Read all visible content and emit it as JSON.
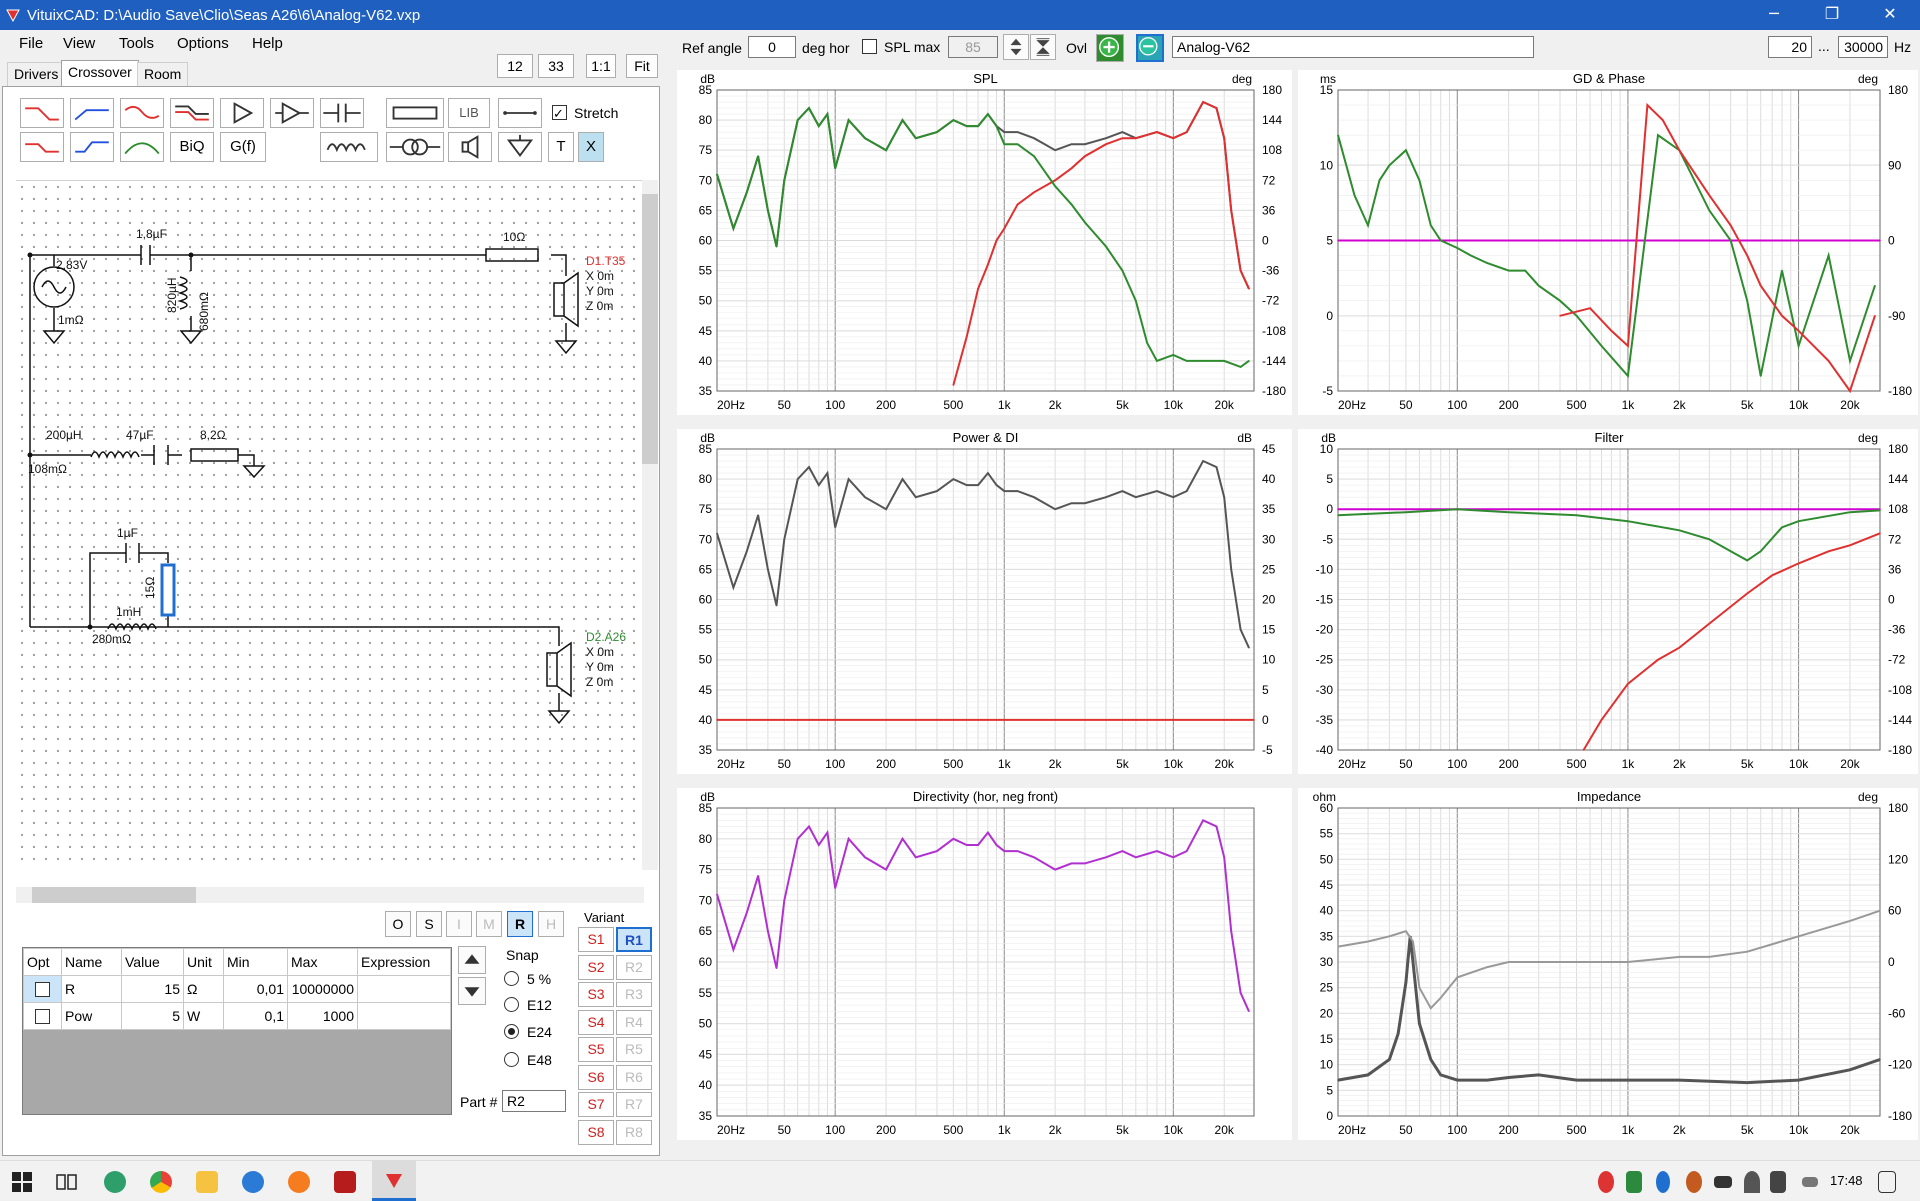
{
  "window": {
    "title": "VituixCAD: D:\\Audio Save\\Clio\\Seas A26\\6\\Analog-V62.vxp",
    "min": "─",
    "restore": "❐",
    "close": "✕"
  },
  "menu": [
    "File",
    "View",
    "Tools",
    "Options",
    "Help"
  ],
  "tabs": [
    "Drivers",
    "Crossover",
    "Room"
  ],
  "schem_toolbar": {
    "v12": "12",
    "v33": "33",
    "one": "1:1",
    "fit": "Fit",
    "lib": "LIB",
    "biq": "BiQ",
    "gf": "G(f)",
    "t": "T",
    "x": "X",
    "stretch": "Stretch"
  },
  "schematic": {
    "src_v": "2,83V",
    "src_r": "1mΩ",
    "c1": "1,8µF",
    "l1": "820µH",
    "l1r": "680mΩ",
    "r1": "10Ω",
    "d1": {
      "name": "D1.T35",
      "x": "X 0m",
      "y": "Y 0m",
      "z": "Z 0m"
    },
    "l2": "200µH",
    "l2r": "108mΩ",
    "c2": "47µF",
    "r2": "8,2Ω",
    "c3": "1µF",
    "r3": "15Ω",
    "l3": "1mH",
    "l3r": "280mΩ",
    "d2": {
      "name": "D2.A26",
      "x": "X 0m",
      "y": "Y 0m",
      "z": "Z 0m"
    }
  },
  "modes": [
    "O",
    "S",
    "I",
    "M",
    "R",
    "H"
  ],
  "param_table": {
    "headers": [
      "Opt",
      "Name",
      "Value",
      "Unit",
      "Min",
      "Max",
      "Expression"
    ],
    "rows": [
      [
        "",
        "R",
        "15",
        "Ω",
        "0,01",
        "10000000",
        ""
      ],
      [
        "",
        "Pow",
        "5",
        "W",
        "0,1",
        "1000",
        ""
      ]
    ]
  },
  "snap": {
    "label": "Snap",
    "options": [
      "5 %",
      "E12",
      "E24",
      "E48"
    ],
    "selected": "E24"
  },
  "part": {
    "label": "Part #",
    "value": "R2"
  },
  "variant": {
    "label": "Variant",
    "s": [
      "S1",
      "S2",
      "S3",
      "S4",
      "S5",
      "S6",
      "S7",
      "S8"
    ],
    "r": [
      "R1",
      "R2",
      "R3",
      "R4",
      "R5",
      "R6",
      "R7",
      "R8"
    ]
  },
  "top_controls": {
    "ref_angle_label": "Ref angle",
    "ref_angle": "0",
    "deg_hor": "deg hor",
    "spl_max_label": "SPL max",
    "spl_max": "85",
    "ovl": "Ovl",
    "variant_name": "Analog-V62",
    "f_low": "20",
    "dots": "...",
    "f_high": "30000",
    "hz": "Hz"
  },
  "colors": {
    "accent": "#1f5fbf",
    "red": "#e03030",
    "green": "#2e8b2e",
    "magenta": "#d000d0",
    "grey": "#555555",
    "purple": "#b030d0"
  },
  "taskbar": {
    "time": "17:48"
  },
  "chart_data": [
    {
      "type": "line",
      "title": "SPL",
      "ylabel": "dB",
      "y2label": "deg",
      "ylim": [
        35,
        85
      ],
      "y2ticks": [
        "180",
        "144",
        "108",
        "72",
        "36",
        "0",
        "-36",
        "-72",
        "-108",
        "-144",
        "-180"
      ],
      "xticks": [
        "20Hz",
        "50",
        "100",
        "200",
        "500",
        "1k",
        "2k",
        "5k",
        "10k",
        "20k"
      ],
      "xlim": [
        20,
        30000
      ],
      "xlog": true,
      "grid": true,
      "series": [
        {
          "color": "#555555",
          "x": [
            20,
            25,
            30,
            35,
            40,
            45,
            50,
            60,
            70,
            80,
            90,
            100,
            120,
            150,
            200,
            250,
            300,
            400,
            500,
            600,
            700,
            800,
            900,
            1000,
            1200,
            1500,
            2000,
            2500,
            3000,
            4000,
            5000,
            6000,
            8000,
            10000,
            12000,
            15000,
            18000,
            20000,
            22000,
            25000,
            28000
          ],
          "y": [
            71,
            62,
            68,
            74,
            65,
            59,
            70,
            80,
            82,
            79,
            81,
            72,
            80,
            77,
            75,
            80,
            77,
            78,
            80,
            79,
            79,
            81,
            79,
            78,
            78,
            77,
            75,
            76,
            76,
            77,
            78,
            77,
            78,
            77,
            78,
            83,
            82,
            77,
            65,
            55,
            52
          ]
        },
        {
          "color": "#e03030",
          "x": [
            500,
            600,
            700,
            800,
            900,
            1000,
            1200,
            1500,
            2000,
            2500,
            3000,
            4000,
            5000,
            6000,
            8000,
            10000,
            12000,
            15000,
            18000,
            20000,
            22000,
            25000,
            28000
          ],
          "y": [
            36,
            44,
            52,
            56,
            60,
            62,
            66,
            68,
            70,
            72,
            74,
            76,
            77,
            77,
            78,
            77,
            78,
            83,
            82,
            77,
            65,
            55,
            52
          ]
        },
        {
          "color": "#2e8b2e",
          "x": [
            20,
            25,
            30,
            35,
            40,
            45,
            50,
            60,
            70,
            80,
            90,
            100,
            120,
            150,
            200,
            250,
            300,
            400,
            500,
            600,
            700,
            800,
            900,
            1000,
            1200,
            1500,
            2000,
            2500,
            3000,
            4000,
            5000,
            6000,
            7000,
            8000,
            10000,
            12000,
            15000,
            20000,
            25000,
            28000
          ],
          "y": [
            71,
            62,
            68,
            74,
            65,
            59,
            70,
            80,
            82,
            79,
            81,
            72,
            80,
            77,
            75,
            80,
            77,
            78,
            80,
            79,
            79,
            81,
            79,
            76,
            76,
            74,
            69,
            66,
            63,
            59,
            55,
            50,
            43,
            40,
            41,
            40,
            40,
            40,
            39,
            40
          ]
        }
      ]
    },
    {
      "type": "line",
      "title": "GD & Phase",
      "ylabel": "ms",
      "y2label": "deg",
      "ylim": [
        -5,
        15
      ],
      "y2ticks": [
        "180",
        "90",
        "0",
        "-90",
        "-180"
      ],
      "xticks": [
        "20Hz",
        "50",
        "100",
        "200",
        "500",
        "1k",
        "2k",
        "5k",
        "10k",
        "20k"
      ],
      "xlim": [
        20,
        30000
      ],
      "xlog": true,
      "grid": true,
      "series": [
        {
          "color": "#d000d0",
          "x": [
            20,
            30000
          ],
          "y": [
            5,
            5
          ]
        },
        {
          "color": "#2e8b2e",
          "x": [
            20,
            25,
            30,
            35,
            40,
            50,
            60,
            70,
            80,
            100,
            120,
            150,
            200,
            250,
            300,
            400,
            500,
            700,
            1000,
            1500,
            2000,
            3000,
            4000,
            5000,
            6000,
            8000,
            10000,
            15000,
            20000,
            28000
          ],
          "y": [
            12,
            8,
            6,
            9,
            10,
            11,
            9,
            6,
            5,
            4.5,
            4,
            3.5,
            3,
            3,
            2,
            1,
            0,
            -2,
            -4,
            12,
            11,
            7,
            5,
            1,
            -4,
            3,
            -2,
            4,
            -3,
            2
          ]
        },
        {
          "color": "#e03030",
          "x": [
            400,
            600,
            800,
            1000,
            1300,
            1600,
            2000,
            3000,
            4000,
            5000,
            6000,
            8000,
            10000,
            15000,
            20000,
            28000
          ],
          "y": [
            0,
            0.5,
            -1,
            -2,
            14,
            13,
            11,
            8,
            6,
            4,
            2,
            0,
            -1,
            -3,
            -5,
            0
          ]
        }
      ]
    },
    {
      "type": "line",
      "title": "Power & DI",
      "ylabel": "dB",
      "y2label": "dB",
      "ylim": [
        35,
        85
      ],
      "y2ticks": [
        "45",
        "40",
        "35",
        "30",
        "25",
        "20",
        "15",
        "10",
        "5",
        "0",
        "-5"
      ],
      "xticks": [
        "20Hz",
        "50",
        "100",
        "200",
        "500",
        "1k",
        "2k",
        "5k",
        "10k",
        "20k"
      ],
      "xlim": [
        20,
        30000
      ],
      "xlog": true,
      "grid": true,
      "series": [
        {
          "color": "#555555",
          "x": [
            20,
            25,
            30,
            35,
            40,
            45,
            50,
            60,
            70,
            80,
            90,
            100,
            120,
            150,
            200,
            250,
            300,
            400,
            500,
            600,
            700,
            800,
            900,
            1000,
            1200,
            1500,
            2000,
            2500,
            3000,
            4000,
            5000,
            6000,
            8000,
            10000,
            12000,
            15000,
            18000,
            20000,
            22000,
            25000,
            28000
          ],
          "y": [
            71,
            62,
            68,
            74,
            65,
            59,
            70,
            80,
            82,
            79,
            81,
            72,
            80,
            77,
            75,
            80,
            77,
            78,
            80,
            79,
            79,
            81,
            79,
            78,
            78,
            77,
            75,
            76,
            76,
            77,
            78,
            77,
            78,
            77,
            78,
            83,
            82,
            77,
            65,
            55,
            52
          ]
        },
        {
          "color": "#e03030",
          "x": [
            20,
            30000
          ],
          "y": [
            40,
            40
          ]
        }
      ]
    },
    {
      "type": "line",
      "title": "Filter",
      "ylabel": "dB",
      "y2label": "deg",
      "ylim": [
        -40,
        10
      ],
      "y2ticks": [
        "180",
        "144",
        "108",
        "72",
        "36",
        "0",
        "-36",
        "-72",
        "-108",
        "-144",
        "-180"
      ],
      "xticks": [
        "20Hz",
        "50",
        "100",
        "200",
        "500",
        "1k",
        "2k",
        "5k",
        "10k",
        "20k"
      ],
      "xlim": [
        20,
        30000
      ],
      "xlog": true,
      "grid": true,
      "series": [
        {
          "color": "#d000d0",
          "x": [
            20,
            30000
          ],
          "y": [
            0,
            0
          ]
        },
        {
          "color": "#2e8b2e",
          "x": [
            20,
            50,
            100,
            200,
            500,
            1000,
            2000,
            3000,
            4000,
            5000,
            6000,
            8000,
            10000,
            20000,
            30000
          ],
          "y": [
            -1,
            -0.5,
            0,
            -0.5,
            -1,
            -2,
            -3.5,
            -5,
            -7,
            -8.5,
            -7,
            -3,
            -2,
            -0.5,
            -0.2
          ]
        },
        {
          "color": "#e03030",
          "x": [
            550,
            700,
            1000,
            1500,
            2000,
            3000,
            5000,
            7000,
            10000,
            15000,
            20000,
            30000
          ],
          "y": [
            -40,
            -35,
            -29,
            -25,
            -23,
            -19,
            -14,
            -11,
            -9,
            -7,
            -6,
            -4
          ]
        }
      ]
    },
    {
      "type": "line",
      "title": "Directivity (hor, neg front)",
      "ylabel": "dB",
      "ylim": [
        35,
        85
      ],
      "xticks": [
        "20Hz",
        "50",
        "100",
        "200",
        "500",
        "1k",
        "2k",
        "5k",
        "10k",
        "20k"
      ],
      "xlim": [
        20,
        30000
      ],
      "xlog": true,
      "grid": true,
      "series": [
        {
          "color": "#b030d0",
          "x": [
            20,
            25,
            30,
            35,
            40,
            45,
            50,
            60,
            70,
            80,
            90,
            100,
            120,
            150,
            200,
            250,
            300,
            400,
            500,
            600,
            700,
            800,
            900,
            1000,
            1200,
            1500,
            2000,
            2500,
            3000,
            4000,
            5000,
            6000,
            8000,
            10000,
            12000,
            15000,
            18000,
            20000,
            22000,
            25000,
            28000
          ],
          "y": [
            71,
            62,
            68,
            74,
            65,
            59,
            70,
            80,
            82,
            79,
            81,
            72,
            80,
            77,
            75,
            80,
            77,
            78,
            80,
            79,
            79,
            81,
            79,
            78,
            78,
            77,
            75,
            76,
            76,
            77,
            78,
            77,
            78,
            77,
            78,
            83,
            82,
            77,
            65,
            55,
            52
          ]
        }
      ]
    },
    {
      "type": "line",
      "title": "Impedance",
      "ylabel": "ohm",
      "y2label": "deg",
      "ylim": [
        0,
        60
      ],
      "y2ticks": [
        "180",
        "120",
        "60",
        "0",
        "-60",
        "-120",
        "-180"
      ],
      "xticks": [
        "20Hz",
        "50",
        "100",
        "200",
        "500",
        "1k",
        "2k",
        "5k",
        "10k",
        "20k"
      ],
      "xlim": [
        20,
        30000
      ],
      "xlog": true,
      "grid": true,
      "series": [
        {
          "color": "#555555",
          "x": [
            20,
            30,
            40,
            45,
            50,
            53,
            55,
            60,
            70,
            80,
            100,
            150,
            200,
            300,
            500,
            1000,
            2000,
            5000,
            10000,
            20000,
            30000
          ],
          "y": [
            7,
            8,
            11,
            16,
            26,
            35,
            30,
            18,
            11,
            8,
            7,
            7,
            7.5,
            8,
            7,
            7,
            7,
            6.5,
            7,
            9,
            11
          ]
        },
        {
          "color": "#999999",
          "x": [
            20,
            30,
            40,
            50,
            55,
            60,
            70,
            80,
            100,
            150,
            200,
            300,
            500,
            1000,
            2000,
            3000,
            5000,
            10000,
            20000,
            30000
          ],
          "y": [
            33,
            34,
            35,
            36,
            34,
            25,
            21,
            23,
            27,
            29,
            30,
            30,
            30,
            30,
            31,
            31,
            32,
            35,
            38,
            40
          ]
        }
      ]
    }
  ]
}
